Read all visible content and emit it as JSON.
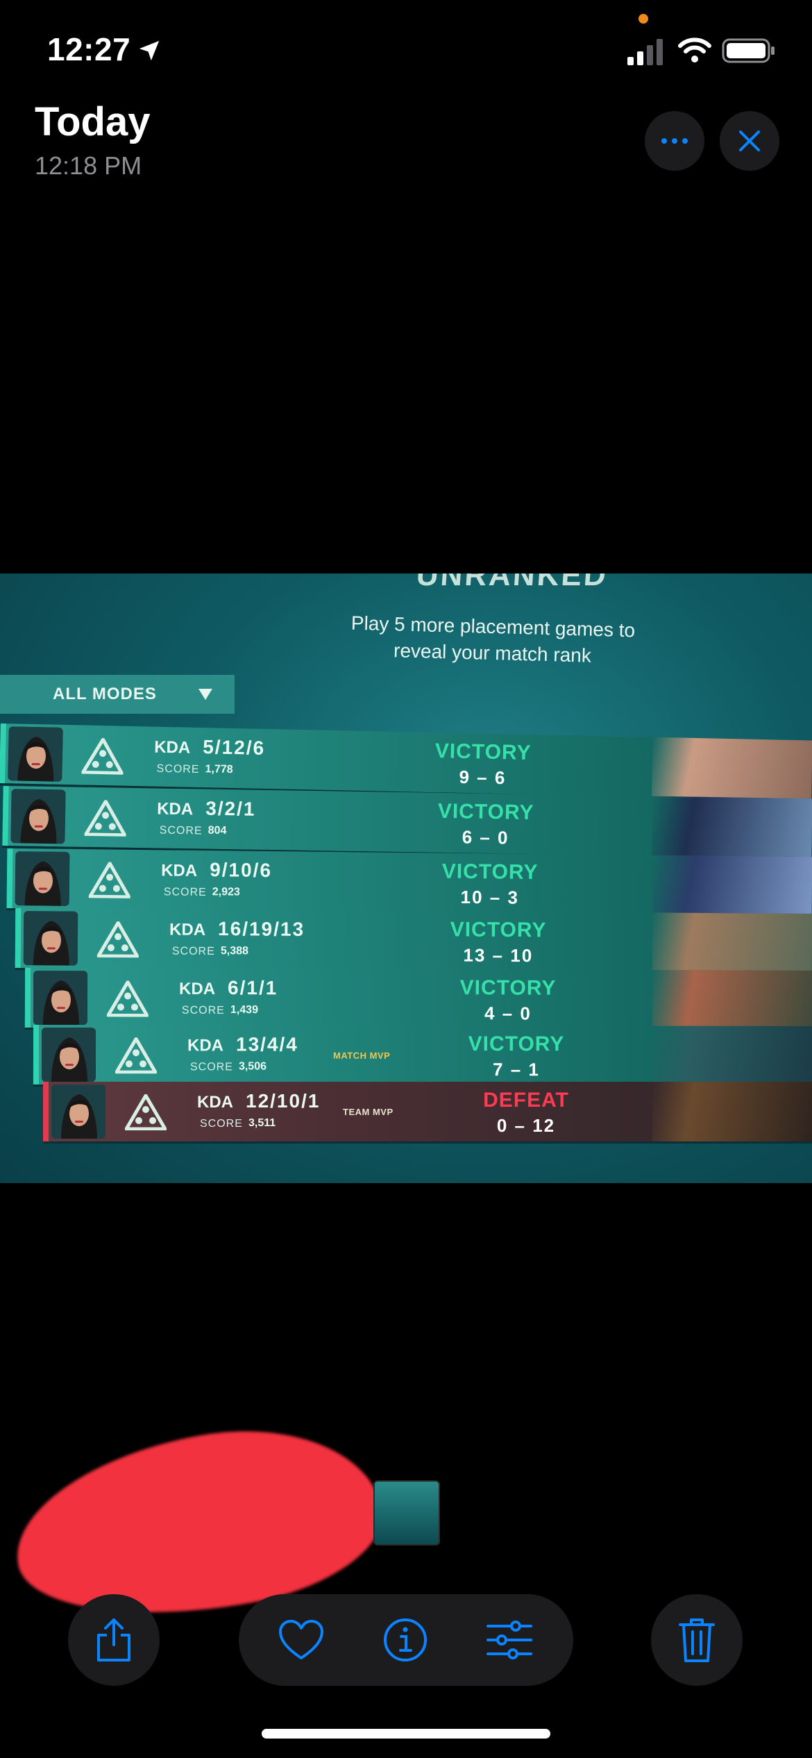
{
  "status_bar": {
    "time": "12:27"
  },
  "header": {
    "title": "Today",
    "subtitle": "12:18 PM"
  },
  "photo": {
    "rank_heading": "UNRANKED",
    "placement_message": "Play 5 more placement games to reveal your match rank",
    "mode_filter": "ALL MODES",
    "matches": [
      {
        "kda_label": "KDA",
        "kda": "5/12/6",
        "score_label": "SCORE",
        "score": "1,778",
        "mvp": "",
        "result": "VICTORY",
        "rounds": "9 – 6"
      },
      {
        "kda_label": "KDA",
        "kda": "3/2/1",
        "score_label": "SCORE",
        "score": "804",
        "mvp": "",
        "result": "VICTORY",
        "rounds": "6 – 0"
      },
      {
        "kda_label": "KDA",
        "kda": "9/10/6",
        "score_label": "SCORE",
        "score": "2,923",
        "mvp": "",
        "result": "VICTORY",
        "rounds": "10 – 3"
      },
      {
        "kda_label": "KDA",
        "kda": "16/19/13",
        "score_label": "SCORE",
        "score": "5,388",
        "mvp": "",
        "result": "VICTORY",
        "rounds": "13 – 10"
      },
      {
        "kda_label": "KDA",
        "kda": "6/1/1",
        "score_label": "SCORE",
        "score": "1,439",
        "mvp": "",
        "result": "VICTORY",
        "rounds": "4 – 0"
      },
      {
        "kda_label": "KDA",
        "kda": "13/4/4",
        "score_label": "SCORE",
        "score": "3,506",
        "mvp": "MATCH MVP",
        "result": "VICTORY",
        "rounds": "7 – 1"
      },
      {
        "kda_label": "KDA",
        "kda": "12/10/1",
        "score_label": "SCORE",
        "score": "3,511",
        "mvp": "TEAM MVP",
        "result": "DEFEAT",
        "rounds": "0 – 12"
      }
    ]
  },
  "toolbar": {
    "icons": [
      "share-icon",
      "heart-icon",
      "info-icon",
      "adjust-icon",
      "trash-icon"
    ],
    "accent_color": "#0a84ff"
  },
  "colors": {
    "victory": "#36e0a8",
    "defeat": "#ff3b54",
    "mvp": "#f2c94c"
  }
}
